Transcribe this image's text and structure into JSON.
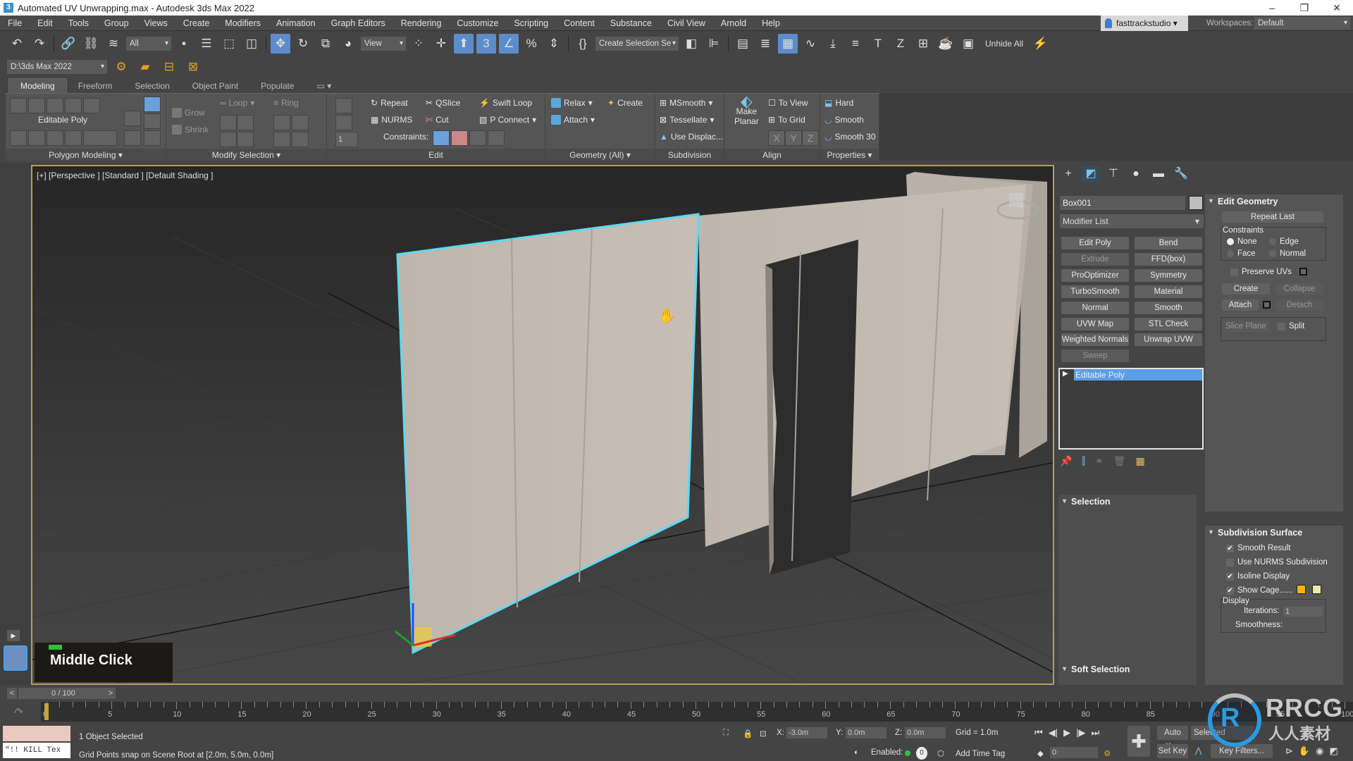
{
  "window": {
    "title": "Automated UV Unwrapping.max - Autodesk 3ds Max 2022",
    "buttons": [
      "–",
      "❐",
      "✕"
    ]
  },
  "menubar": {
    "items": [
      "File",
      "Edit",
      "Tools",
      "Group",
      "Views",
      "Create",
      "Modifiers",
      "Animation",
      "Graph Editors",
      "Rendering",
      "Customize",
      "Scripting",
      "Content",
      "Substance",
      "Civil View",
      "Arnold",
      "Help"
    ],
    "user": "fasttrackstudio ▾",
    "workspaces_label": "Workspaces:",
    "workspace_value": "Default"
  },
  "toolbar1": {
    "selection_filter": "All",
    "ref_coord": "View",
    "named_selection": "Create Selection Se",
    "unhide_all": "Unhide All"
  },
  "toolbar2": {
    "project_path": "D:\\3ds Max 2022"
  },
  "ribbon": {
    "tabs": [
      "Modeling",
      "Freeform",
      "Selection",
      "Object Paint",
      "Populate"
    ],
    "active_tab": "Modeling",
    "polygon_modeling": {
      "label": "Polygon Modeling ▾",
      "object_type": "Editable Poly"
    },
    "modify_selection": {
      "label": "Modify Selection ▾",
      "grow": "Grow",
      "shrink": "Shrink",
      "loop": "Loop",
      "ring": "Ring",
      "spinner": "1"
    },
    "edit": {
      "label": "Edit",
      "repeat": "Repeat",
      "qslice": "QSlice",
      "swift_loop": "Swift Loop",
      "nurms": "NURMS",
      "cut": "Cut",
      "p_connect": "P Connect",
      "constraints": "Constraints:"
    },
    "geometry": {
      "label": "Geometry (All) ▾",
      "relax": "Relax",
      "create": "Create",
      "attach": "Attach"
    },
    "subdivision": {
      "label": "Subdivision",
      "msmooth": "MSmooth",
      "tessellate": "Tessellate",
      "use_displac": "Use Displac..."
    },
    "align": {
      "label": "Align",
      "make_planar_1": "Make",
      "make_planar_2": "Planar",
      "to_view": "To View",
      "to_grid": "To Grid",
      "x": "X",
      "y": "Y",
      "z": "Z"
    },
    "properties": {
      "label": "Properties ▾",
      "hard": "Hard",
      "smooth": "Smooth",
      "smooth30": "Smooth 30"
    }
  },
  "viewport": {
    "label": "[+] [Perspective ] [Standard ] [Default Shading ]",
    "overlay_text": "Middle Click",
    "overlay_indicator_color": "#2fbf3c",
    "selection_color": "#5fd8f0"
  },
  "command_panel": {
    "object_name": "Box001",
    "modifier_list": "Modifier List",
    "modifier_buttons": [
      "Edit Poly",
      "Bend",
      "Extrude",
      "FFD(box)",
      "ProOptimizer",
      "Symmetry",
      "TurboSmooth",
      "Material",
      "Normal",
      "Smooth",
      "UVW Map",
      "STL Check",
      "Weighted Normals",
      "Unwrap UVW",
      "Sweep"
    ],
    "disabled_modifier_buttons": [
      "Extrude",
      "Sweep"
    ],
    "stack_item": "Editable Poly",
    "selection_rollout": "Selection",
    "soft_selection_rollout": "Soft Selection",
    "edit_geometry": {
      "title": "Edit Geometry",
      "repeat_last": "Repeat Last",
      "constraints_label": "Constraints",
      "constraints": [
        {
          "label": "None",
          "selected": true
        },
        {
          "label": "Edge",
          "selected": false
        },
        {
          "label": "Face",
          "selected": false
        },
        {
          "label": "Normal",
          "selected": false
        }
      ],
      "preserve_uvs": {
        "label": "Preserve UVs",
        "checked": false
      },
      "create": "Create",
      "collapse": "Collapse",
      "attach": "Attach",
      "detach": "Detach",
      "slice_plane": "Slice Plane",
      "split": {
        "label": "Split",
        "checked": false
      }
    },
    "subdivision_surface": {
      "title": "Subdivision Surface",
      "smooth_result": {
        "label": "Smooth Result",
        "checked": true
      },
      "use_nurms": {
        "label": "Use NURMS Subdivision",
        "checked": false
      },
      "isoline_display": {
        "label": "Isoline Display",
        "checked": true
      },
      "show_cage": {
        "label": "Show Cage......",
        "checked": true,
        "color1": "#f2b600",
        "color2": "#efeaa0"
      },
      "display_label": "Display",
      "iterations_label": "Iterations:",
      "iterations_value": "1",
      "smoothness_label": "Smoothness:"
    }
  },
  "timeline": {
    "frame_display": "0 / 100",
    "current_frame": 0,
    "start": 0,
    "end": 100,
    "labels": [
      "0",
      "5",
      "10",
      "15",
      "20",
      "25",
      "30",
      "35",
      "40",
      "45",
      "50",
      "55",
      "60",
      "65",
      "70",
      "75",
      "80",
      "85",
      "90",
      "95",
      "100"
    ]
  },
  "status": {
    "script_listener": "\"!! KILL Tex",
    "selection": "1 Object Selected",
    "prompt": "Grid Points snap on Scene Root at [2.0m, 5.0m, 0.0m]",
    "x_label": "X:",
    "x": "-3.0m",
    "y_label": "Y:",
    "y": "0.0m",
    "z_label": "Z:",
    "z": "0.0m",
    "grid": "Grid = 1.0m",
    "enabled_label": "Enabled:",
    "add_time_tag": "Add Time Tag",
    "frame_spinner": "0",
    "auto_key": "Auto Key",
    "set_key": "Set Key",
    "selected_dd": "Selected",
    "key_filters": "Key Filters..."
  },
  "watermark": {
    "logo": "RRCG",
    "sub": "人人素材"
  }
}
